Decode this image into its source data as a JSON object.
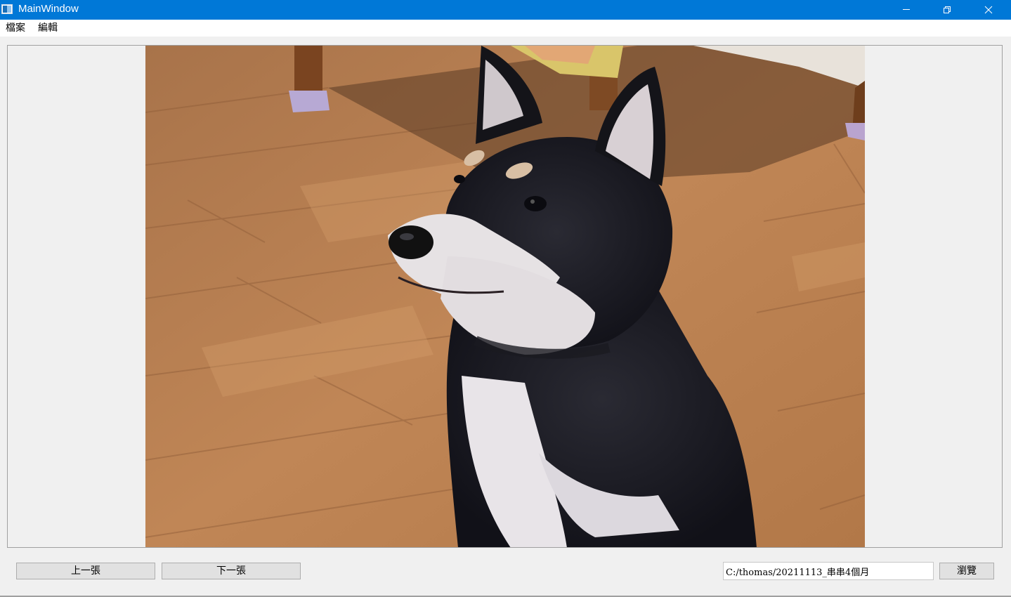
{
  "window": {
    "title": "MainWindow",
    "controls": [
      "minimize-icon",
      "restore-icon",
      "close-icon"
    ],
    "title_bar_color": "#0078d7"
  },
  "menu": {
    "items": [
      {
        "label": "檔案"
      },
      {
        "label": "編輯"
      }
    ]
  },
  "viewer": {
    "image_icon": "photo-of-black-shiba-inu-puppy-on-wooden-floor"
  },
  "controls": {
    "prev_label": "上一張",
    "next_label": "下一張",
    "path_value": "C:/thomas/20211113_串串4個月",
    "browse_label": "瀏覽"
  }
}
